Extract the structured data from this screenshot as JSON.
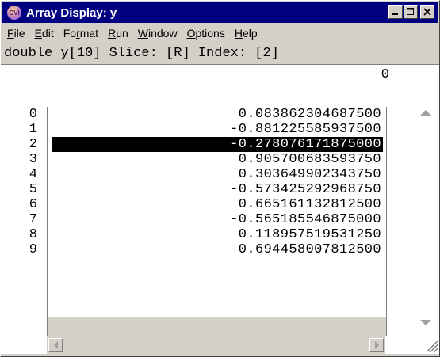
{
  "window": {
    "title": "Array Display: y",
    "app_icon_text": "CVI"
  },
  "menu": [
    {
      "label": "File",
      "mnemonic": "F",
      "rest": "ile"
    },
    {
      "label": "Edit",
      "mnemonic": "E",
      "rest": "dit"
    },
    {
      "label": "Format",
      "pre": "Fo",
      "mnemonic": "r",
      "rest": "mat"
    },
    {
      "label": "Run",
      "mnemonic": "R",
      "rest": "un"
    },
    {
      "label": "Window",
      "mnemonic": "W",
      "rest": "indow"
    },
    {
      "label": "Options",
      "mnemonic": "O",
      "rest": "ptions"
    },
    {
      "label": "Help",
      "mnemonic": "H",
      "rest": "elp"
    }
  ],
  "info": {
    "declaration": "double y[10]",
    "slice_label": "Slice:",
    "slice_value": "[R]",
    "index_label": "Index:",
    "index_value": "[2]"
  },
  "column_header": "0",
  "rows": [
    {
      "index": "0",
      "value": "0.083862304687500"
    },
    {
      "index": "1",
      "value": "-0.881225585937500"
    },
    {
      "index": "2",
      "value": "-0.278076171875000",
      "selected": true
    },
    {
      "index": "3",
      "value": "0.905700683593750"
    },
    {
      "index": "4",
      "value": "0.303649902343750"
    },
    {
      "index": "5",
      "value": "-0.573425292968750"
    },
    {
      "index": "6",
      "value": "0.665161132812500"
    },
    {
      "index": "7",
      "value": "-0.565185546875000"
    },
    {
      "index": "8",
      "value": "0.118957519531250"
    },
    {
      "index": "9",
      "value": "0.694458007812500"
    }
  ],
  "colors": {
    "titlebar": "#000080",
    "selection_bg": "#000000",
    "selection_fg": "#ffffff",
    "chrome": "#d4d0c8"
  }
}
